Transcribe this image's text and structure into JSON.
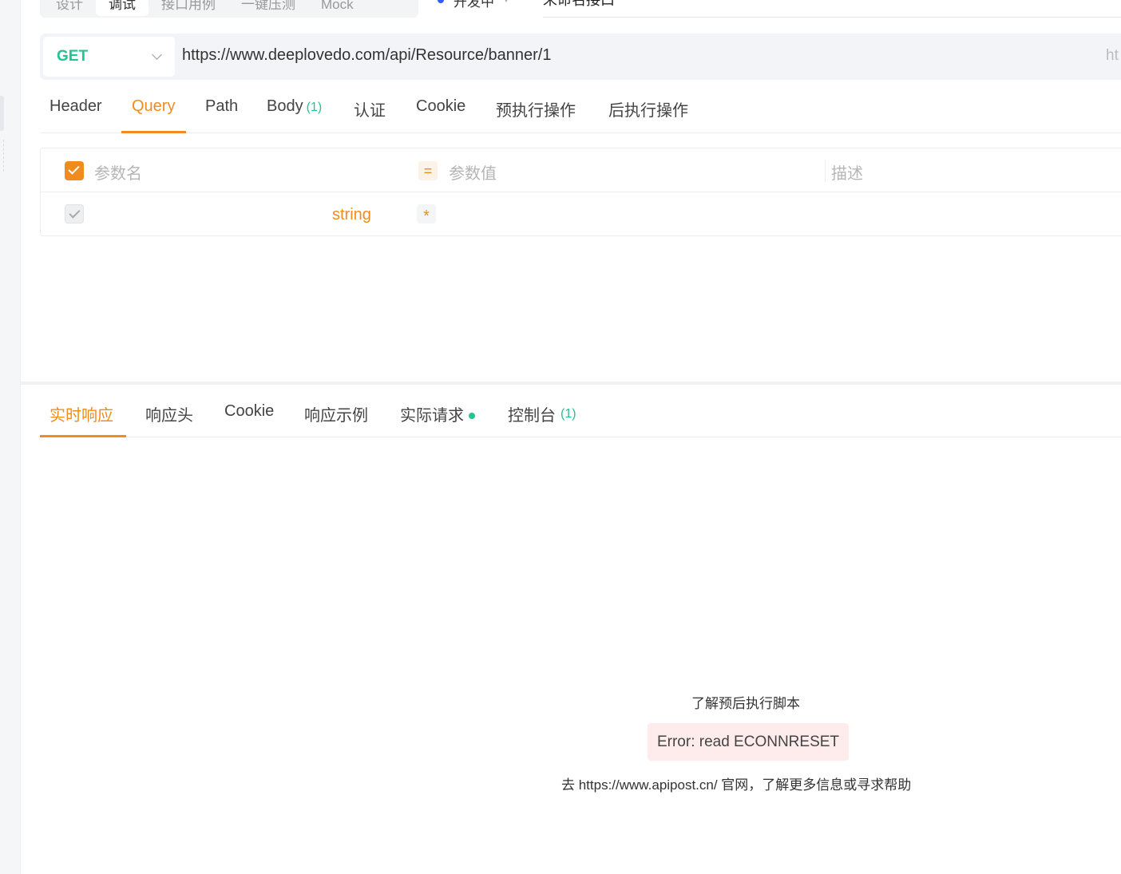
{
  "mode_tabs": [
    "设计",
    "调试",
    "接口用例",
    "一键压测",
    "Mock"
  ],
  "status_label": "开发中",
  "api_name": "未命名接口",
  "request": {
    "method": "GET",
    "url": "https://www.deeplovedo.com/api/Resource/banner/1",
    "url_overflow_hint": "ht"
  },
  "request_tabs": {
    "header": "Header",
    "query": "Query",
    "path": "Path",
    "body": "Body",
    "body_count": "(1)",
    "auth": "认证",
    "cookie": "Cookie",
    "pre_script": "预执行操作",
    "post_script": "后执行操作",
    "active": "Query"
  },
  "params_table": {
    "name_placeholder": "参数名",
    "equals_symbol": "=",
    "value_placeholder": "参数值",
    "desc_placeholder": "描述",
    "row_type": "string",
    "required_marker": "*"
  },
  "response_tabs": {
    "realtime": "实时响应",
    "headers": "响应头",
    "cookie": "Cookie",
    "example": "响应示例",
    "actual_request": "实际请求",
    "console": "控制台",
    "console_count": "(1)",
    "active": "实时响应"
  },
  "response": {
    "learn_link": "了解预后执行脚本",
    "error": "Error: read ECONNRESET",
    "help": "去 https://www.apipost.cn/ 官网，了解更多信息或寻求帮助"
  },
  "colors": {
    "accent": "#f08c1e",
    "method_get": "#23c490",
    "status_dot": "#2f5dff",
    "error_bg": "#fdeceb"
  }
}
